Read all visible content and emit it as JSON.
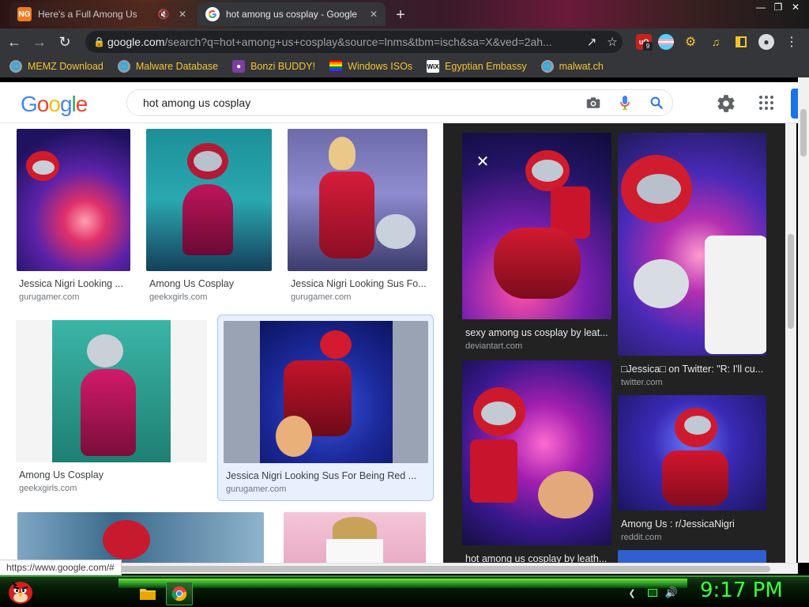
{
  "browser": {
    "tabs": [
      {
        "title": "Here's a Full Among Us",
        "active": false
      },
      {
        "title": "hot among us cosplay - Google",
        "active": true
      }
    ],
    "address": {
      "domain": "google.com",
      "path": "/search?q=hot+among+us+cosplay&source=lnms&tbm=isch&sa=X&ved=2ah..."
    },
    "extension_badge": "9",
    "bookmarks": [
      {
        "label": "MEMZ Download",
        "icon": "globe-icon"
      },
      {
        "label": "Malware Database",
        "icon": "globe-icon"
      },
      {
        "label": "Bonzi BUDDY!",
        "icon": "bonzi-icon"
      },
      {
        "label": "Windows ISOs",
        "icon": "windows-icon"
      },
      {
        "label": "Egyptian Embassy",
        "icon": "wix-icon"
      },
      {
        "label": "malwat.ch",
        "icon": "globe-icon"
      }
    ]
  },
  "google": {
    "logo": "Google",
    "query": "hot among us cosplay"
  },
  "results": [
    {
      "title": "Jessica Nigri Looking ...",
      "source": "gurugamer.com"
    },
    {
      "title": "Among Us Cosplay",
      "source": "geekxgirls.com"
    },
    {
      "title": "Jessica Nigri Looking Sus Fo...",
      "source": "gurugamer.com"
    },
    {
      "title": "Among Us Cosplay",
      "source": "geekxgirls.com"
    },
    {
      "title": "Jessica Nigri Looking Sus For Being Red ...",
      "source": "gurugamer.com"
    }
  ],
  "preview": {
    "items": [
      {
        "title": "sexy among us cosplay by leat...",
        "source": "deviantart.com"
      },
      {
        "title": "□Jessica□ on Twitter: \"R: I'll cu...",
        "source": "twitter.com"
      },
      {
        "title": "hot among us cosplay by leath...",
        "source": ""
      },
      {
        "title": "Among Us : r/JessicaNigri",
        "source": "reddit.com"
      }
    ]
  },
  "status_url": "https://www.google.com/#",
  "taskbar": {
    "clock": "9:17 PM"
  },
  "colors": {
    "google_blue": "#4285F4",
    "google_red": "#EA4335",
    "google_yellow": "#FBBC05",
    "google_green": "#34A853",
    "bookmark_text": "#f4c430",
    "clock": "#3cff3c"
  }
}
